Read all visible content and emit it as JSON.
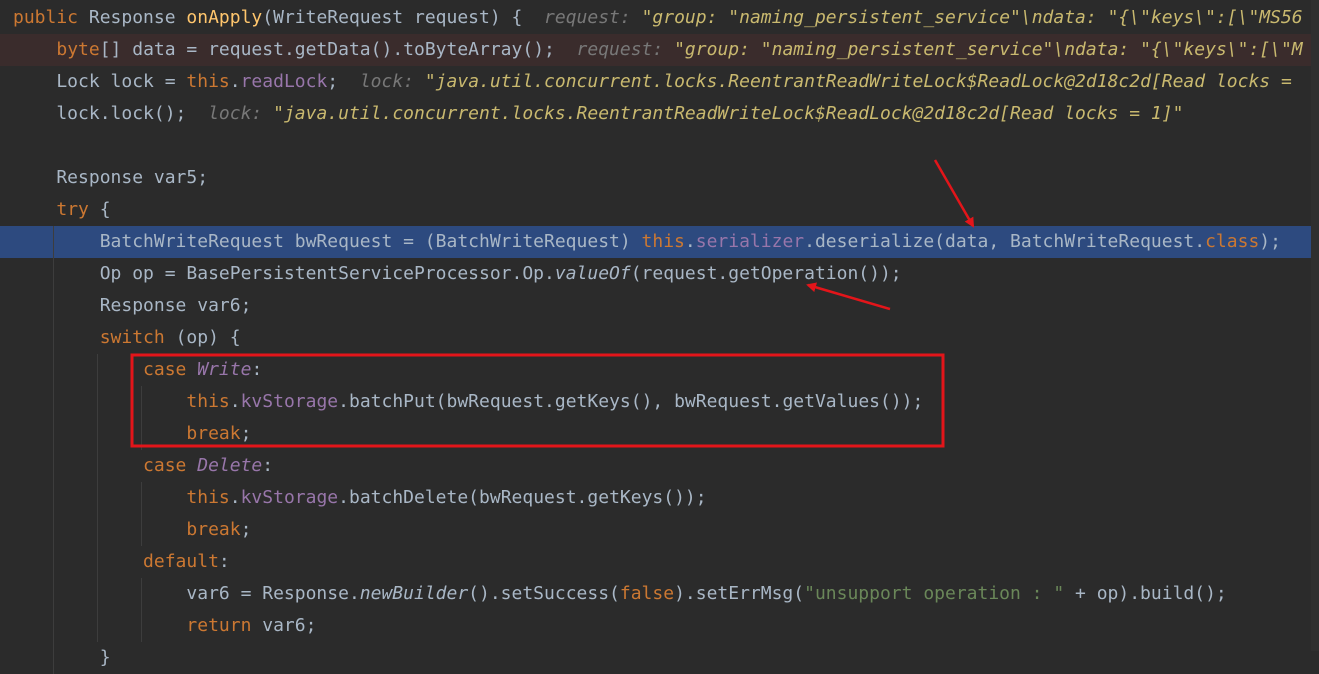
{
  "editor": {
    "lines": [
      {
        "seg": [
          [
            "kw",
            "public"
          ],
          [
            "p",
            " Response "
          ],
          [
            "fn",
            "onApply"
          ],
          [
            "p",
            "(WriteRequest request) {  "
          ],
          [
            "inlay",
            "request: "
          ],
          [
            "val",
            "\"group: \"naming_persistent_service\"\\ndata: \"{\\\"keys\\\":[\\\"MS56"
          ]
        ]
      },
      {
        "seg": [
          [
            "p",
            "    "
          ],
          [
            "kw",
            "byte"
          ],
          [
            "p",
            "[] data = request.getData().toByteArray();  "
          ],
          [
            "inlay",
            "request: "
          ],
          [
            "val",
            "\"group: \"naming_persistent_service\"\\ndata: \"{\\\"keys\\\":[\\\"M"
          ]
        ]
      },
      {
        "seg": [
          [
            "p",
            "    Lock lock = "
          ],
          [
            "kw",
            "this"
          ],
          [
            "p",
            "."
          ],
          [
            "fld",
            "readLock"
          ],
          [
            "p",
            ";  "
          ],
          [
            "inlay",
            "lock: "
          ],
          [
            "val",
            "\"java.util.concurrent.locks.ReentrantReadWriteLock$ReadLock@2d18c2d[Read locks = "
          ]
        ]
      },
      {
        "seg": [
          [
            "p",
            "    lock.lock();  "
          ],
          [
            "inlay",
            "lock: "
          ],
          [
            "val",
            "\"java.util.concurrent.locks.ReentrantReadWriteLock$ReadLock@2d18c2d[Read locks = 1]\""
          ]
        ]
      },
      {
        "seg": []
      },
      {
        "seg": [
          [
            "p",
            "    Response var5;"
          ]
        ]
      },
      {
        "seg": [
          [
            "p",
            "    "
          ],
          [
            "kw",
            "try"
          ],
          [
            "p",
            " {"
          ]
        ]
      },
      {
        "seg": [
          [
            "p",
            "        BatchWriteRequest bwRequest = (BatchWriteRequest) "
          ],
          [
            "kw",
            "this"
          ],
          [
            "p",
            "."
          ],
          [
            "fld",
            "serializer"
          ],
          [
            "p",
            ".deserialize(data, BatchWriteRequest."
          ],
          [
            "kw",
            "class"
          ],
          [
            "p",
            ");"
          ]
        ]
      },
      {
        "seg": [
          [
            "p",
            "        Op op = BasePersistentServiceProcessor.Op."
          ],
          [
            "sti",
            "valueOf"
          ],
          [
            "p",
            "(request.getOperation());"
          ]
        ]
      },
      {
        "seg": [
          [
            "p",
            "        Response var6;"
          ]
        ]
      },
      {
        "seg": [
          [
            "p",
            "        "
          ],
          [
            "kw",
            "switch"
          ],
          [
            "p",
            " (op) {"
          ]
        ]
      },
      {
        "seg": [
          [
            "p",
            "            "
          ],
          [
            "kw",
            "case"
          ],
          [
            "p",
            " "
          ],
          [
            "itl",
            "Write"
          ],
          [
            "p",
            ":"
          ]
        ]
      },
      {
        "seg": [
          [
            "p",
            "                "
          ],
          [
            "kw",
            "this"
          ],
          [
            "p",
            "."
          ],
          [
            "fld",
            "kvStorage"
          ],
          [
            "p",
            ".batchPut(bwRequest.getKeys(), bwRequest.getValues());"
          ]
        ]
      },
      {
        "seg": [
          [
            "p",
            "                "
          ],
          [
            "kw",
            "break"
          ],
          [
            "p",
            ";"
          ]
        ]
      },
      {
        "seg": [
          [
            "p",
            "            "
          ],
          [
            "kw",
            "case"
          ],
          [
            "p",
            " "
          ],
          [
            "itl",
            "Delete"
          ],
          [
            "p",
            ":"
          ]
        ]
      },
      {
        "seg": [
          [
            "p",
            "                "
          ],
          [
            "kw",
            "this"
          ],
          [
            "p",
            "."
          ],
          [
            "fld",
            "kvStorage"
          ],
          [
            "p",
            ".batchDelete(bwRequest.getKeys());"
          ]
        ]
      },
      {
        "seg": [
          [
            "p",
            "                "
          ],
          [
            "kw",
            "break"
          ],
          [
            "p",
            ";"
          ]
        ]
      },
      {
        "seg": [
          [
            "p",
            "            "
          ],
          [
            "kw",
            "default"
          ],
          [
            "p",
            ":"
          ]
        ]
      },
      {
        "seg": [
          [
            "p",
            "                var6 = Response."
          ],
          [
            "sti",
            "newBuilder"
          ],
          [
            "p",
            "().setSuccess("
          ],
          [
            "kw",
            "false"
          ],
          [
            "p",
            ").setErrMsg("
          ],
          [
            "str",
            "\"unsupport operation : \""
          ],
          [
            "p",
            " + op).build();"
          ]
        ]
      },
      {
        "seg": [
          [
            "p",
            "                "
          ],
          [
            "kw",
            "return"
          ],
          [
            "p",
            " var6;"
          ]
        ]
      },
      {
        "seg": [
          [
            "p",
            "        }"
          ]
        ]
      }
    ],
    "execution_line": 7,
    "breakpoint_line": 1,
    "colors": {
      "background": "#2b2b2b",
      "execution_highlight": "#2d4a7f",
      "annotation_red": "#e3151a",
      "keyword": "#cc7832",
      "method_decl": "#ffc66d",
      "field": "#9876aa",
      "string": "#6a8759",
      "plain": "#a9b7c6",
      "inlay_value": "#c9b96f"
    }
  },
  "annotations": {
    "arrows": [
      "arrow-to-deserialize",
      "arrow-to-getOperation"
    ],
    "box": "case-write-block"
  }
}
